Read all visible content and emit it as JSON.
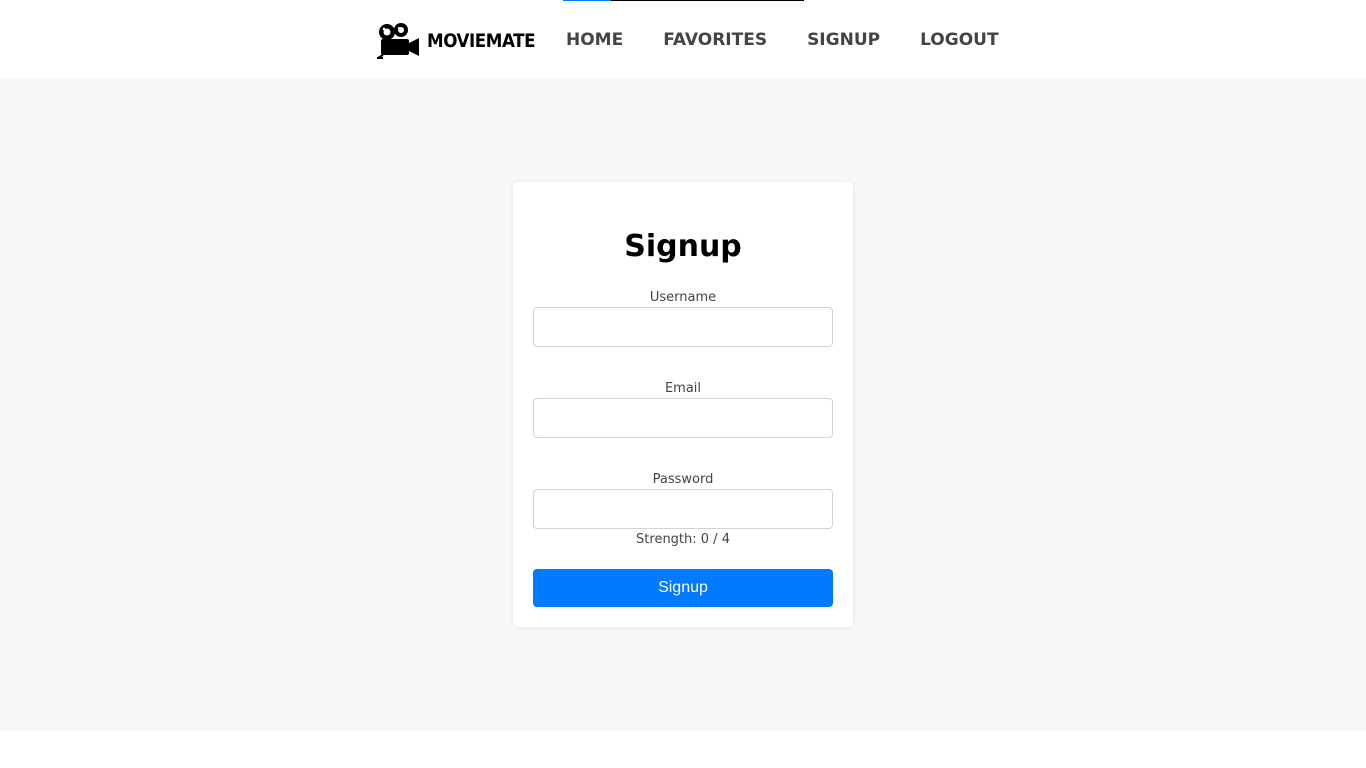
{
  "app": {
    "brand": "MOVIEMATE",
    "logo_icon": "film-camera-icon"
  },
  "nav": {
    "items": [
      {
        "label": "HOME"
      },
      {
        "label": "FAVORITES"
      },
      {
        "label": "SIGNUP"
      },
      {
        "label": "LOGOUT"
      }
    ],
    "active_color": "#007bff"
  },
  "form": {
    "title": "Signup",
    "username": {
      "label": "Username",
      "value": "",
      "placeholder": ""
    },
    "email": {
      "label": "Email",
      "value": "",
      "placeholder": ""
    },
    "password": {
      "label": "Password",
      "value": "",
      "placeholder": ""
    },
    "strength_text": "Strength: 0 / 4",
    "submit_label": "Signup"
  },
  "colors": {
    "button": "#007bff",
    "page_background": "#f7f8fa",
    "nav_text": "#444444"
  }
}
